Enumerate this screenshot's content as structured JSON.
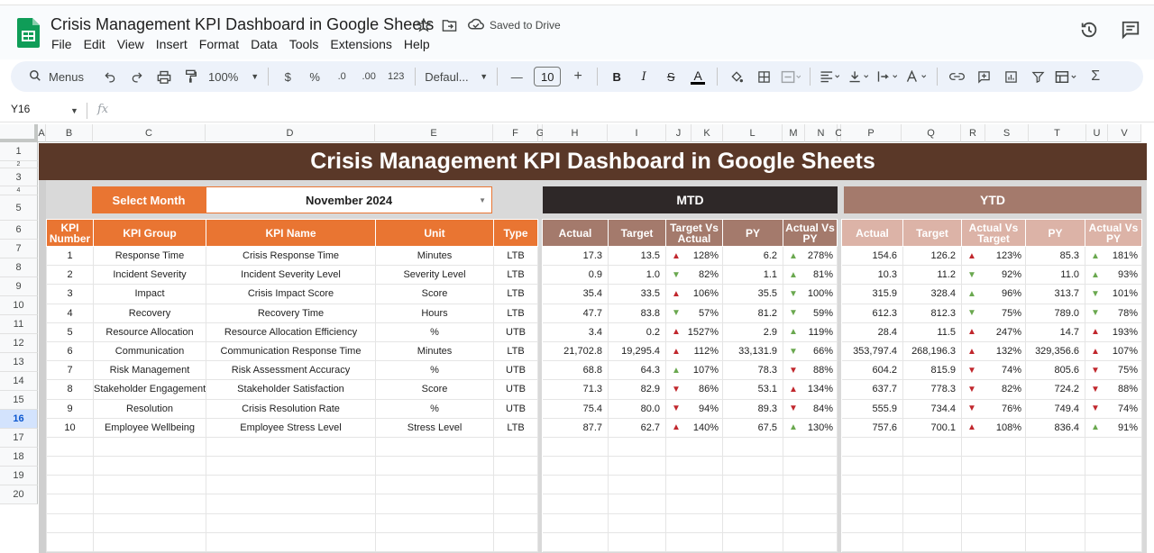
{
  "app": {
    "doc_title": "Crisis Management KPI Dashboard in Google Sheets",
    "saved_status": "Saved to Drive",
    "menu": [
      "File",
      "Edit",
      "View",
      "Insert",
      "Format",
      "Data",
      "Tools",
      "Extensions",
      "Help"
    ]
  },
  "toolbar": {
    "search_label": "Menus",
    "zoom": "100%",
    "currency": "$",
    "percent": "%",
    "decimal_dec": ".0",
    "decimal_inc": ".00",
    "number_format": "123",
    "font": "Defaul...",
    "font_size": "10"
  },
  "formula_bar": {
    "name_box": "Y16",
    "fx": "fx"
  },
  "columns": [
    "A",
    "B",
    "C",
    "D",
    "E",
    "F",
    "G",
    "H",
    "I",
    "J",
    "K",
    "L",
    "M",
    "N",
    "O",
    "P",
    "Q",
    "R",
    "S",
    "T",
    "U",
    "V"
  ],
  "rows": [
    "1",
    "2",
    "3",
    "4",
    "5",
    "6",
    "7",
    "8",
    "9",
    "10",
    "11",
    "12",
    "13",
    "14",
    "15",
    "16",
    "17",
    "18",
    "19",
    "20"
  ],
  "selected_row": "16",
  "dashboard": {
    "title": "Crisis Management KPI Dashboard in Google Sheets",
    "select_month_label": "Select Month",
    "selected_month": "November 2024",
    "mtd_label": "MTD",
    "ytd_label": "YTD",
    "left_headers": [
      "KPI Number",
      "KPI Group",
      "KPI Name",
      "Unit",
      "Type"
    ],
    "mtd_headers": [
      "Actual",
      "Target",
      "Target Vs Actual",
      "PY",
      "Actual Vs PY"
    ],
    "ytd_headers": [
      "Actual",
      "Target",
      "Actual Vs Target",
      "PY",
      "Actual Vs PY"
    ],
    "kpis": [
      {
        "num": "1",
        "group": "Response Time",
        "name": "Crisis Response Time",
        "unit": "Minutes",
        "type": "LTB",
        "mtd": {
          "actual": "17.3",
          "target": "13.5",
          "tva": "128%",
          "tva_dir": "up",
          "tva_good": false,
          "py": "6.2",
          "avp": "278%",
          "avp_dir": "up",
          "avp_good": true
        },
        "ytd": {
          "actual": "154.6",
          "target": "126.2",
          "avt": "123%",
          "avt_dir": "up",
          "avt_good": false,
          "py": "85.3",
          "avp": "181%",
          "avp_dir": "up",
          "avp_good": true
        }
      },
      {
        "num": "2",
        "group": "Incident Severity",
        "name": "Incident Severity Level",
        "unit": "Severity Level",
        "type": "LTB",
        "mtd": {
          "actual": "0.9",
          "target": "1.0",
          "tva": "82%",
          "tva_dir": "down",
          "tva_good": true,
          "py": "1.1",
          "avp": "81%",
          "avp_dir": "up",
          "avp_good": true
        },
        "ytd": {
          "actual": "10.3",
          "target": "11.2",
          "avt": "92%",
          "avt_dir": "down",
          "avt_good": true,
          "py": "11.0",
          "avp": "93%",
          "avp_dir": "up",
          "avp_good": true
        }
      },
      {
        "num": "3",
        "group": "Impact",
        "name": "Crisis Impact Score",
        "unit": "Score",
        "type": "LTB",
        "mtd": {
          "actual": "35.4",
          "target": "33.5",
          "tva": "106%",
          "tva_dir": "up",
          "tva_good": false,
          "py": "35.5",
          "avp": "100%",
          "avp_dir": "down",
          "avp_good": true
        },
        "ytd": {
          "actual": "315.9",
          "target": "328.4",
          "avt": "96%",
          "avt_dir": "up",
          "avt_good": true,
          "py": "313.7",
          "avp": "101%",
          "avp_dir": "down",
          "avp_good": true
        }
      },
      {
        "num": "4",
        "group": "Recovery",
        "name": "Recovery Time",
        "unit": "Hours",
        "type": "LTB",
        "mtd": {
          "actual": "47.7",
          "target": "83.8",
          "tva": "57%",
          "tva_dir": "down",
          "tva_good": true,
          "py": "81.2",
          "avp": "59%",
          "avp_dir": "down",
          "avp_good": true
        },
        "ytd": {
          "actual": "612.3",
          "target": "812.3",
          "avt": "75%",
          "avt_dir": "down",
          "avt_good": true,
          "py": "789.0",
          "avp": "78%",
          "avp_dir": "down",
          "avp_good": true
        }
      },
      {
        "num": "5",
        "group": "Resource Allocation",
        "name": "Resource Allocation Efficiency",
        "unit": "%",
        "type": "UTB",
        "mtd": {
          "actual": "3.4",
          "target": "0.2",
          "tva": "1527%",
          "tva_dir": "up",
          "tva_good": false,
          "py": "2.9",
          "avp": "119%",
          "avp_dir": "up",
          "avp_good": true
        },
        "ytd": {
          "actual": "28.4",
          "target": "11.5",
          "avt": "247%",
          "avt_dir": "up",
          "avt_good": false,
          "py": "14.7",
          "avp": "193%",
          "avp_dir": "up",
          "avp_good": false
        }
      },
      {
        "num": "6",
        "group": "Communication",
        "name": "Communication Response Time",
        "unit": "Minutes",
        "type": "LTB",
        "mtd": {
          "actual": "21,702.8",
          "target": "19,295.4",
          "tva": "112%",
          "tva_dir": "up",
          "tva_good": false,
          "py": "33,131.9",
          "avp": "66%",
          "avp_dir": "down",
          "avp_good": true
        },
        "ytd": {
          "actual": "353,797.4",
          "target": "268,196.3",
          "avt": "132%",
          "avt_dir": "up",
          "avt_good": false,
          "py": "329,356.6",
          "avp": "107%",
          "avp_dir": "up",
          "avp_good": false
        }
      },
      {
        "num": "7",
        "group": "Risk Management",
        "name": "Risk Assessment Accuracy",
        "unit": "%",
        "type": "UTB",
        "mtd": {
          "actual": "68.8",
          "target": "64.3",
          "tva": "107%",
          "tva_dir": "up",
          "tva_good": true,
          "py": "78.3",
          "avp": "88%",
          "avp_dir": "down",
          "avp_good": false
        },
        "ytd": {
          "actual": "604.2",
          "target": "815.9",
          "avt": "74%",
          "avt_dir": "down",
          "avt_good": false,
          "py": "805.6",
          "avp": "75%",
          "avp_dir": "down",
          "avp_good": false
        }
      },
      {
        "num": "8",
        "group": "Stakeholder Engagement",
        "name": "Stakeholder Satisfaction",
        "unit": "Score",
        "type": "UTB",
        "mtd": {
          "actual": "71.3",
          "target": "82.9",
          "tva": "86%",
          "tva_dir": "down",
          "tva_good": false,
          "py": "53.1",
          "avp": "134%",
          "avp_dir": "up",
          "avp_good": false
        },
        "ytd": {
          "actual": "637.7",
          "target": "778.3",
          "avt": "82%",
          "avt_dir": "down",
          "avt_good": false,
          "py": "724.2",
          "avp": "88%",
          "avp_dir": "down",
          "avp_good": false
        }
      },
      {
        "num": "9",
        "group": "Resolution",
        "name": "Crisis Resolution Rate",
        "unit": "%",
        "type": "UTB",
        "mtd": {
          "actual": "75.4",
          "target": "80.0",
          "tva": "94%",
          "tva_dir": "down",
          "tva_good": false,
          "py": "89.3",
          "avp": "84%",
          "avp_dir": "down",
          "avp_good": false
        },
        "ytd": {
          "actual": "555.9",
          "target": "734.4",
          "avt": "76%",
          "avt_dir": "down",
          "avt_good": false,
          "py": "749.4",
          "avp": "74%",
          "avp_dir": "down",
          "avp_good": false
        }
      },
      {
        "num": "10",
        "group": "Employee Wellbeing",
        "name": "Employee Stress Level",
        "unit": "Stress Level",
        "type": "LTB",
        "mtd": {
          "actual": "87.7",
          "target": "62.7",
          "tva": "140%",
          "tva_dir": "up",
          "tva_good": false,
          "py": "67.5",
          "avp": "130%",
          "avp_dir": "up",
          "avp_good": true
        },
        "ytd": {
          "actual": "757.6",
          "target": "700.1",
          "avt": "108%",
          "avt_dir": "up",
          "avt_good": false,
          "py": "836.4",
          "avp": "91%",
          "avp_dir": "up",
          "avp_good": true
        }
      }
    ]
  },
  "colors": {
    "banner": "#5a3828",
    "orange": "#e97532",
    "mtd_dark": "#2e2828",
    "mtd_head": "#a47a6c",
    "ytd_head": "#dcb3a7",
    "bad": "#c1272d",
    "good": "#6aa84f"
  }
}
